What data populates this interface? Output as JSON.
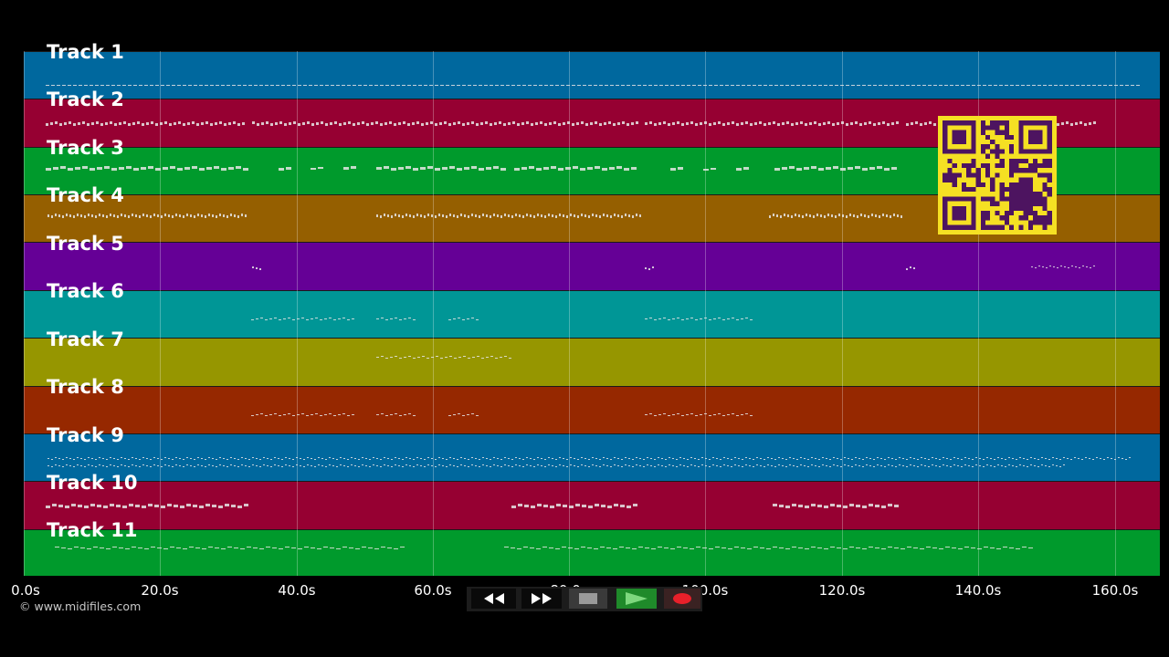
{
  "tracks": [
    {
      "label": "Track 1",
      "color": "#00689e"
    },
    {
      "label": "Track 2",
      "color": "#960032"
    },
    {
      "label": "Track 3",
      "color": "#009a2c"
    },
    {
      "label": "Track 4",
      "color": "#955f00"
    },
    {
      "label": "Track 5",
      "color": "#650096"
    },
    {
      "label": "Track 6",
      "color": "#009696"
    },
    {
      "label": "Track 7",
      "color": "#969600"
    },
    {
      "label": "Track 8",
      "color": "#962800"
    },
    {
      "label": "Track 9",
      "color": "#00689e"
    },
    {
      "label": "Track 10",
      "color": "#960032"
    },
    {
      "label": "Track 11",
      "color": "#009a2c"
    }
  ],
  "timeline": {
    "ticks": [
      "0.0s",
      "20.0s",
      "40.0s",
      "60.0s",
      "80.0s",
      "100.0s",
      "120.0s",
      "140.0s",
      "160.0s"
    ]
  },
  "copyright": "© www.midifiles.com",
  "controls": {
    "rewind": "rewind-icon",
    "fast_forward": "fast-forward-icon",
    "stop": "stop-icon",
    "play": "play-icon",
    "record": "record-icon"
  },
  "qr_code": "qr-code-icon",
  "colors": {
    "background": "#000000",
    "play": "#1f8a2a",
    "record": "#e8202a",
    "qr_bg": "#f5e023",
    "qr_fg": "#4d1460"
  }
}
